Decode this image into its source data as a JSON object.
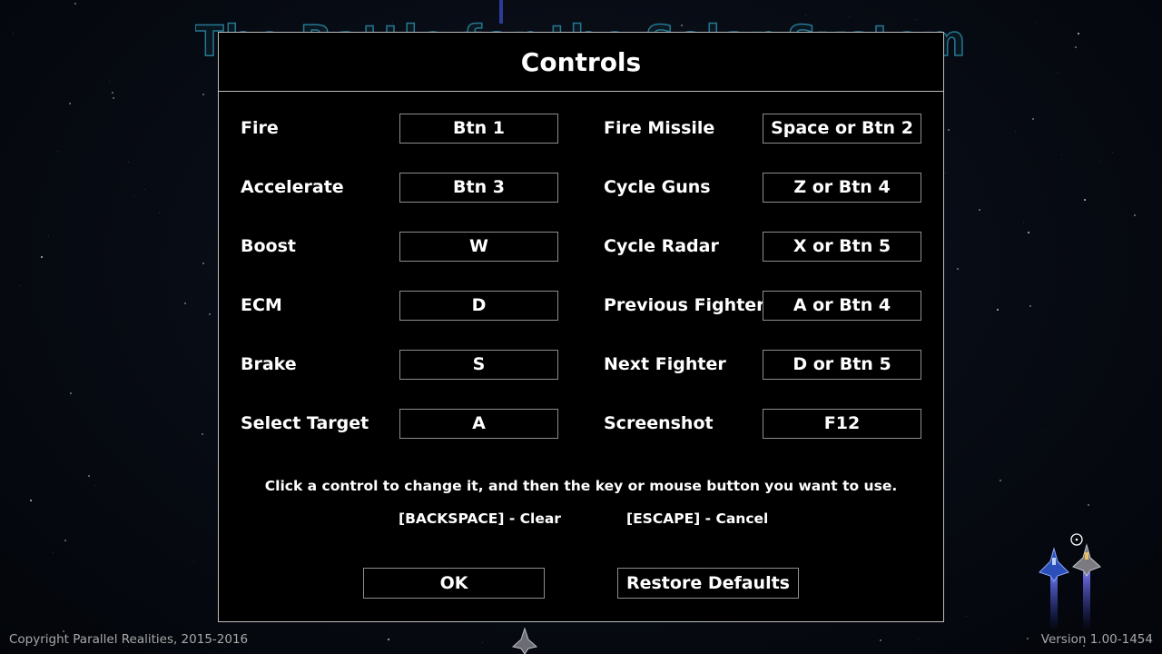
{
  "background": {
    "game_title": "The Battle for the Solar System"
  },
  "dialog": {
    "title": "Controls",
    "controls_left": [
      {
        "label": "Fire",
        "key": "Btn 1"
      },
      {
        "label": "Accelerate",
        "key": "Btn 3"
      },
      {
        "label": "Boost",
        "key": "W"
      },
      {
        "label": "ECM",
        "key": "D"
      },
      {
        "label": "Brake",
        "key": "S"
      },
      {
        "label": "Select Target",
        "key": "A"
      }
    ],
    "controls_right": [
      {
        "label": "Fire Missile",
        "key": "Space or Btn 2"
      },
      {
        "label": "Cycle Guns",
        "key": "Z or Btn 4"
      },
      {
        "label": "Cycle Radar",
        "key": "X or Btn 5"
      },
      {
        "label": "Previous Fighter",
        "key": "A or Btn 4"
      },
      {
        "label": "Next Fighter",
        "key": "D or Btn 5"
      },
      {
        "label": "Screenshot",
        "key": "F12"
      }
    ],
    "instruction": "Click a control to change it, and then the key or mouse button you want to use.",
    "hint_clear": "[BACKSPACE] - Clear",
    "hint_cancel": "[ESCAPE] - Cancel",
    "ok_label": "OK",
    "restore_label": "Restore Defaults"
  },
  "footer": {
    "copyright": "Copyright Parallel Realities, 2015-2016",
    "version": "Version 1.00-1454"
  },
  "colors": {
    "border": "#bdbdbd",
    "key_border": "#8e8e8e",
    "title_outline": "#2c8aa8",
    "footer_text": "#a8a8a8"
  },
  "icons": [
    "blue-fighter-ship-icon",
    "grey-fighter-ship-icon",
    "player-ship-icon",
    "crosshair-cursor-icon"
  ]
}
